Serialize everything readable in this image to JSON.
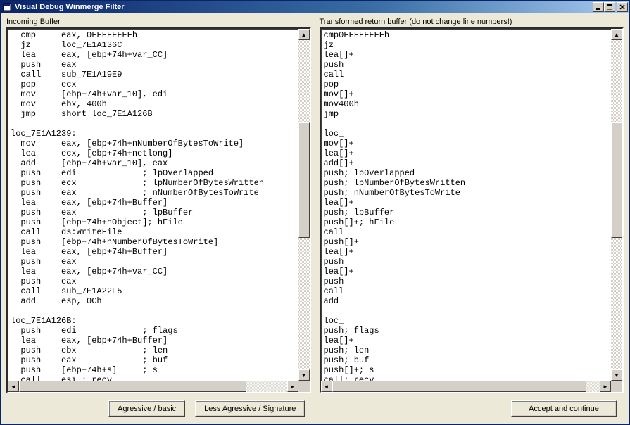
{
  "window": {
    "title": "Visual Debug Winmerge Filter"
  },
  "left": {
    "label": "Incoming Buffer",
    "content": "  cmp     eax, 0FFFFFFFFh\n  jz      loc_7E1A136C\n  lea     eax, [ebp+74h+var_CC]\n  push    eax\n  call    sub_7E1A19E9\n  pop     ecx\n  mov     [ebp+74h+var_10], edi\n  mov     ebx, 400h\n  jmp     short loc_7E1A126B\n\nloc_7E1A1239:\n  mov     eax, [ebp+74h+nNumberOfBytesToWrite]\n  lea     ecx, [ebp+74h+netlong]\n  add     [ebp+74h+var_10], eax\n  push    edi             ; lpOverlapped\n  push    ecx             ; lpNumberOfBytesWritten\n  push    eax             ; nNumberOfBytesToWrite\n  lea     eax, [ebp+74h+Buffer]\n  push    eax             ; lpBuffer\n  push    [ebp+74h+hObject]; hFile\n  call    ds:WriteFile\n  push    [ebp+74h+nNumberOfBytesToWrite]\n  lea     eax, [ebp+74h+Buffer]\n  push    eax\n  lea     eax, [ebp+74h+var_CC]\n  push    eax\n  call    sub_7E1A22F5\n  add     esp, 0Ch\n\nloc_7E1A126B:\n  push    edi             ; flags\n  lea     eax, [ebp+74h+Buffer]\n  push    ebx             ; len\n  push    eax             ; buf\n  push    [ebp+74h+s]     ; s\n  call    esi ; recv\n  cmp     eax, edi"
  },
  "right": {
    "label": "Transformed return buffer (do not change line numbers!)",
    "content": "cmp0FFFFFFFFh\njz\nlea[]+\npush\ncall\npop\nmov[]+\nmov400h\njmp\n\nloc_\nmov[]+\nlea[]+\nadd[]+\npush; lpOverlapped\npush; lpNumberOfBytesWritten\npush; nNumberOfBytesToWrite\nlea[]+\npush; lpBuffer\npush[]+; hFile\ncall\npush[]+\nlea[]+\npush\nlea[]+\npush\ncall\nadd\n\nloc_\npush; flags\nlea[]+\npush; len\npush; buf\npush[]+; s\ncall; recv\ncmp"
  },
  "buttons": {
    "aggressive": "Agressive / basic",
    "less_aggressive": "Less Agressive / Signature",
    "accept": "Accept and continue"
  }
}
